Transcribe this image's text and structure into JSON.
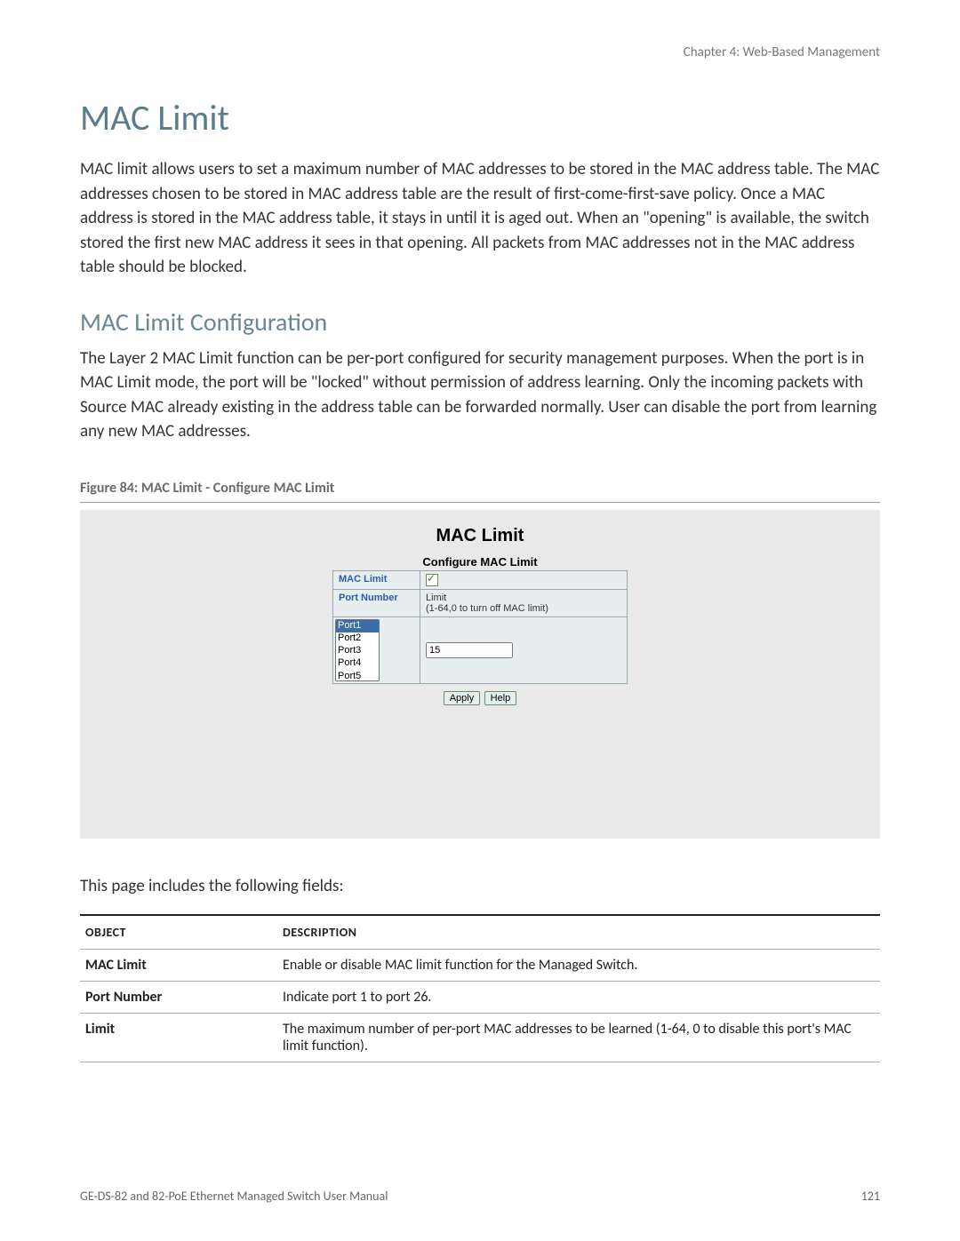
{
  "header": {
    "chapter": "Chapter 4: Web-Based Management"
  },
  "title": "MAC Limit",
  "intro_paragraph": "MAC limit allows users to set a maximum number of MAC addresses to be stored in the MAC address table. The MAC addresses chosen to be stored in MAC address table are the result of first-come-first-save policy. Once a MAC address is stored in the MAC address table, it stays in until it is aged out. When an \"opening\" is available, the switch stored the first new MAC address it sees in that opening. All packets from MAC addresses not in the MAC address table should be blocked.",
  "subtitle": "MAC Limit Configuration",
  "config_paragraph": "The Layer 2 MAC Limit function can be per-port configured for security management purposes. When the port is in MAC Limit mode, the port will be \"locked\" without permission of address learning. Only the incoming packets with Source MAC already existing in the address table can be forwarded normally. User can disable the port from learning any new MAC addresses.",
  "figure": {
    "caption": "Figure 84: MAC Limit - Configure MAC Limit",
    "panel_title": "MAC Limit",
    "panel_subtitle": "Configure MAC Limit",
    "rows": {
      "mac_limit_label": "MAC Limit",
      "port_number_label": "Port Number",
      "limit_label": "Limit",
      "limit_hint": "(1-64,0 to turn off MAC limit)",
      "ports": [
        "Port1",
        "Port2",
        "Port3",
        "Port4",
        "Port5"
      ],
      "limit_value": "15",
      "apply": "Apply",
      "help": "Help"
    }
  },
  "fields_intro": "This page includes the following fields:",
  "fields_table": {
    "col1": "Object",
    "col2": "Description",
    "rows": [
      {
        "object": "MAC Limit",
        "description": "Enable or disable MAC limit function for the Managed Switch."
      },
      {
        "object": "Port Number",
        "description": "Indicate port 1 to port 26."
      },
      {
        "object": "Limit",
        "description": "The maximum number of per-port MAC addresses to be learned (1-64, 0 to disable this port's MAC limit function)."
      }
    ]
  },
  "footer": {
    "manual": "GE-DS-82 and 82-PoE Ethernet Managed Switch User Manual",
    "page": "121"
  }
}
